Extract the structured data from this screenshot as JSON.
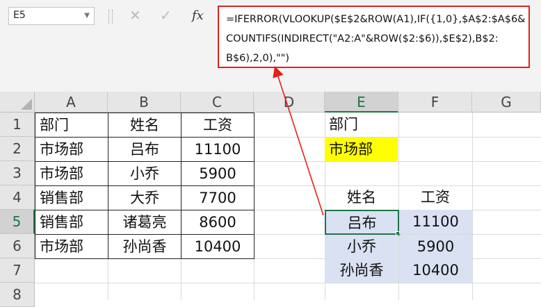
{
  "name_box": {
    "value": "E5"
  },
  "formula_bar": {
    "lines": [
      "=IFERROR(VLOOKUP($E$2&ROW(A1),IF({1,0},$A$2:$A$6&",
      "COUNTIFS(INDIRECT(\"A2:A\"&ROW($2:$6)),$E$2),B$2:",
      "B$6),2,0),\"\")"
    ]
  },
  "toolbar": {
    "cancel_icon": "✕",
    "enter_icon": "✓",
    "fx_icon": "fx"
  },
  "columns": [
    "A",
    "B",
    "C",
    "D",
    "E",
    "F",
    "G"
  ],
  "rows": [
    "1",
    "2",
    "3",
    "4",
    "5",
    "6",
    "7",
    "8"
  ],
  "table": {
    "headers": [
      "部门",
      "姓名",
      "工资"
    ],
    "rows": [
      [
        "市场部",
        "吕布",
        "11100"
      ],
      [
        "市场部",
        "小乔",
        "5900"
      ],
      [
        "销售部",
        "大乔",
        "7700"
      ],
      [
        "销售部",
        "诸葛亮",
        "8600"
      ],
      [
        "市场部",
        "孙尚香",
        "10400"
      ]
    ]
  },
  "lookup": {
    "label": "部门",
    "value": "市场部",
    "result_headers": [
      "姓名",
      "工资"
    ],
    "results": [
      [
        "吕布",
        "11100"
      ],
      [
        "小乔",
        "5900"
      ],
      [
        "孙尚香",
        "10400"
      ]
    ]
  },
  "colors": {
    "annotation": "#e2201c",
    "selection": "#217346",
    "highlight_yellow": "#ffff00",
    "result_fill": "#d9e1f2"
  }
}
